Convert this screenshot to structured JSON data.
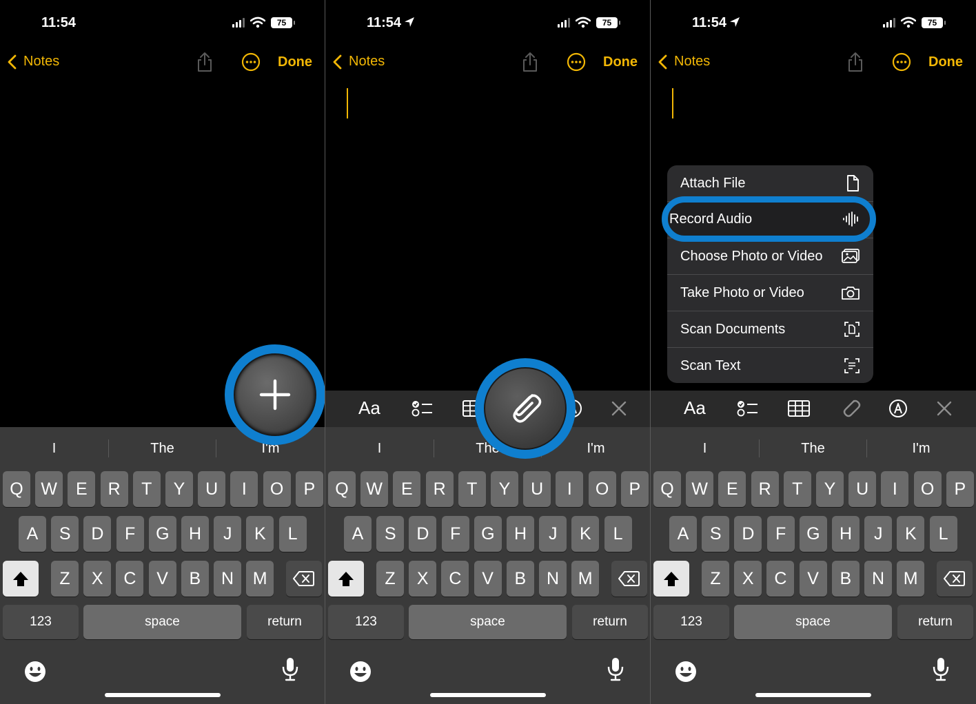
{
  "status": {
    "time": "11:54",
    "battery": "75"
  },
  "nav": {
    "back_label": "Notes",
    "done_label": "Done"
  },
  "toolbar": {
    "text_format_label": "Aa"
  },
  "suggestions": [
    "I",
    "The",
    "I'm"
  ],
  "keyboard": {
    "row1": [
      "Q",
      "W",
      "E",
      "R",
      "T",
      "Y",
      "U",
      "I",
      "O",
      "P"
    ],
    "row2": [
      "A",
      "S",
      "D",
      "F",
      "G",
      "H",
      "J",
      "K",
      "L"
    ],
    "row3": [
      "Z",
      "X",
      "C",
      "V",
      "B",
      "N",
      "M"
    ],
    "numbers_label": "123",
    "space_label": "space",
    "return_label": "return"
  },
  "attach_menu": {
    "items": [
      {
        "label": "Attach File",
        "icon": "document-icon"
      },
      {
        "label": "Record Audio",
        "icon": "waveform-icon"
      },
      {
        "label": "Choose Photo or Video",
        "icon": "photo-library-icon"
      },
      {
        "label": "Take Photo or Video",
        "icon": "camera-icon"
      },
      {
        "label": "Scan Documents",
        "icon": "scan-document-icon"
      },
      {
        "label": "Scan Text",
        "icon": "scan-text-icon"
      }
    ]
  },
  "colors": {
    "accent": "#f2b705",
    "highlight": "#0f7fcf",
    "keyboard_bg": "#3a3a3a",
    "key_bg": "#6b6b6b"
  }
}
